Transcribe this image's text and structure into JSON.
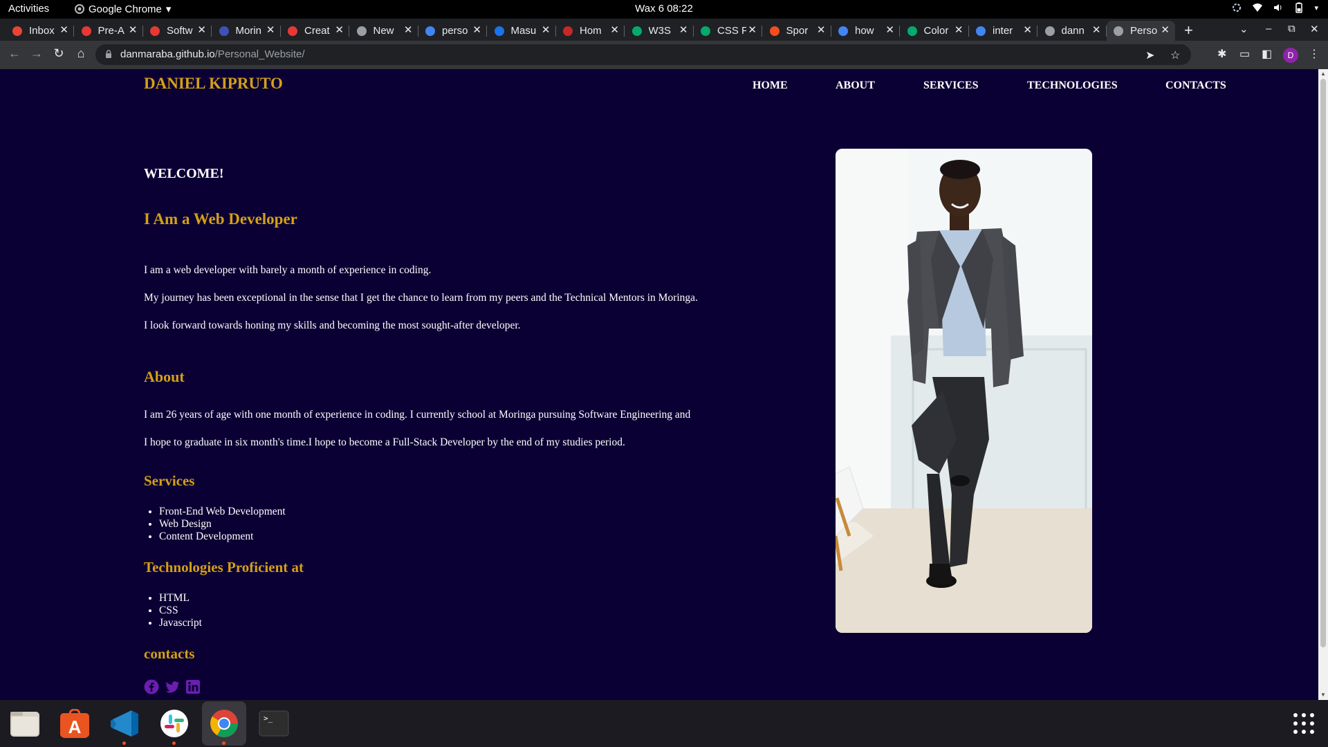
{
  "topbar": {
    "activities": "Activities",
    "app_name": "Google Chrome",
    "clock": "Wax 6  08:22"
  },
  "tabs": [
    {
      "title": "Inbox",
      "color": "#ea4335"
    },
    {
      "title": "Pre-A",
      "color": "#e53935"
    },
    {
      "title": "Softw",
      "color": "#e53935"
    },
    {
      "title": "Morin",
      "color": "#3f51b5"
    },
    {
      "title": "Creat",
      "color": "#e53935"
    },
    {
      "title": "New",
      "color": "#9aa0a6"
    },
    {
      "title": "perso",
      "color": "#4285f4"
    },
    {
      "title": "Masu",
      "color": "#1a73e8"
    },
    {
      "title": "Hom",
      "color": "#c62828"
    },
    {
      "title": "W3S",
      "color": "#04aa6d"
    },
    {
      "title": "CSS F",
      "color": "#04aa6d"
    },
    {
      "title": "Spor",
      "color": "#f24e1e"
    },
    {
      "title": "how",
      "color": "#4285f4"
    },
    {
      "title": "Color",
      "color": "#04aa6d"
    },
    {
      "title": "inter",
      "color": "#4285f4"
    },
    {
      "title": "dann",
      "color": "#9aa0a6"
    },
    {
      "title": "Perso",
      "color": "#9aa0a6",
      "active": true
    }
  ],
  "omnibox": {
    "host": "danmaraba.github.io",
    "path": "/Personal_Website/"
  },
  "site": {
    "brand": "DANIEL KIPRUTO",
    "nav": [
      "HOME",
      "ABOUT",
      "SERVICES",
      "TECHNOLOGIES",
      "CONTACTS"
    ],
    "welcome": "WELCOME!",
    "intro_heading": "I Am a Web Developer",
    "intro_paragraphs": [
      "I am a web developer with barely a month of experience in coding.",
      "My journey has been exceptional in the sense that I get the chance to learn from my peers and the Technical Mentors in Moringa.",
      "I look forward towards honing my skills and becoming the most sought-after developer."
    ],
    "about_heading": "About",
    "about_paragraphs": [
      "I am 26 years of age with one month of experience in coding. I currently school at Moringa pursuing Software Engineering and",
      "I hope to graduate in six month's time.I hope to become a Full-Stack Developer by the end of my studies period."
    ],
    "services_heading": "Services",
    "services": [
      "Front-End Web Development",
      "Web Design",
      "Content Development"
    ],
    "tech_heading": "Technologies Proficient at",
    "technologies": [
      "HTML",
      "CSS",
      "Javascript"
    ],
    "contacts_heading": "contacts",
    "social_icons": [
      "facebook-icon",
      "twitter-icon",
      "linkedin-icon"
    ],
    "colors": {
      "background": "#0b0033",
      "accent": "#d4a017",
      "social": "#6a1fb0"
    }
  },
  "dock": [
    "files-icon",
    "app-store-icon",
    "vscode-icon",
    "slack-icon",
    "chrome-icon",
    "terminal-icon"
  ]
}
